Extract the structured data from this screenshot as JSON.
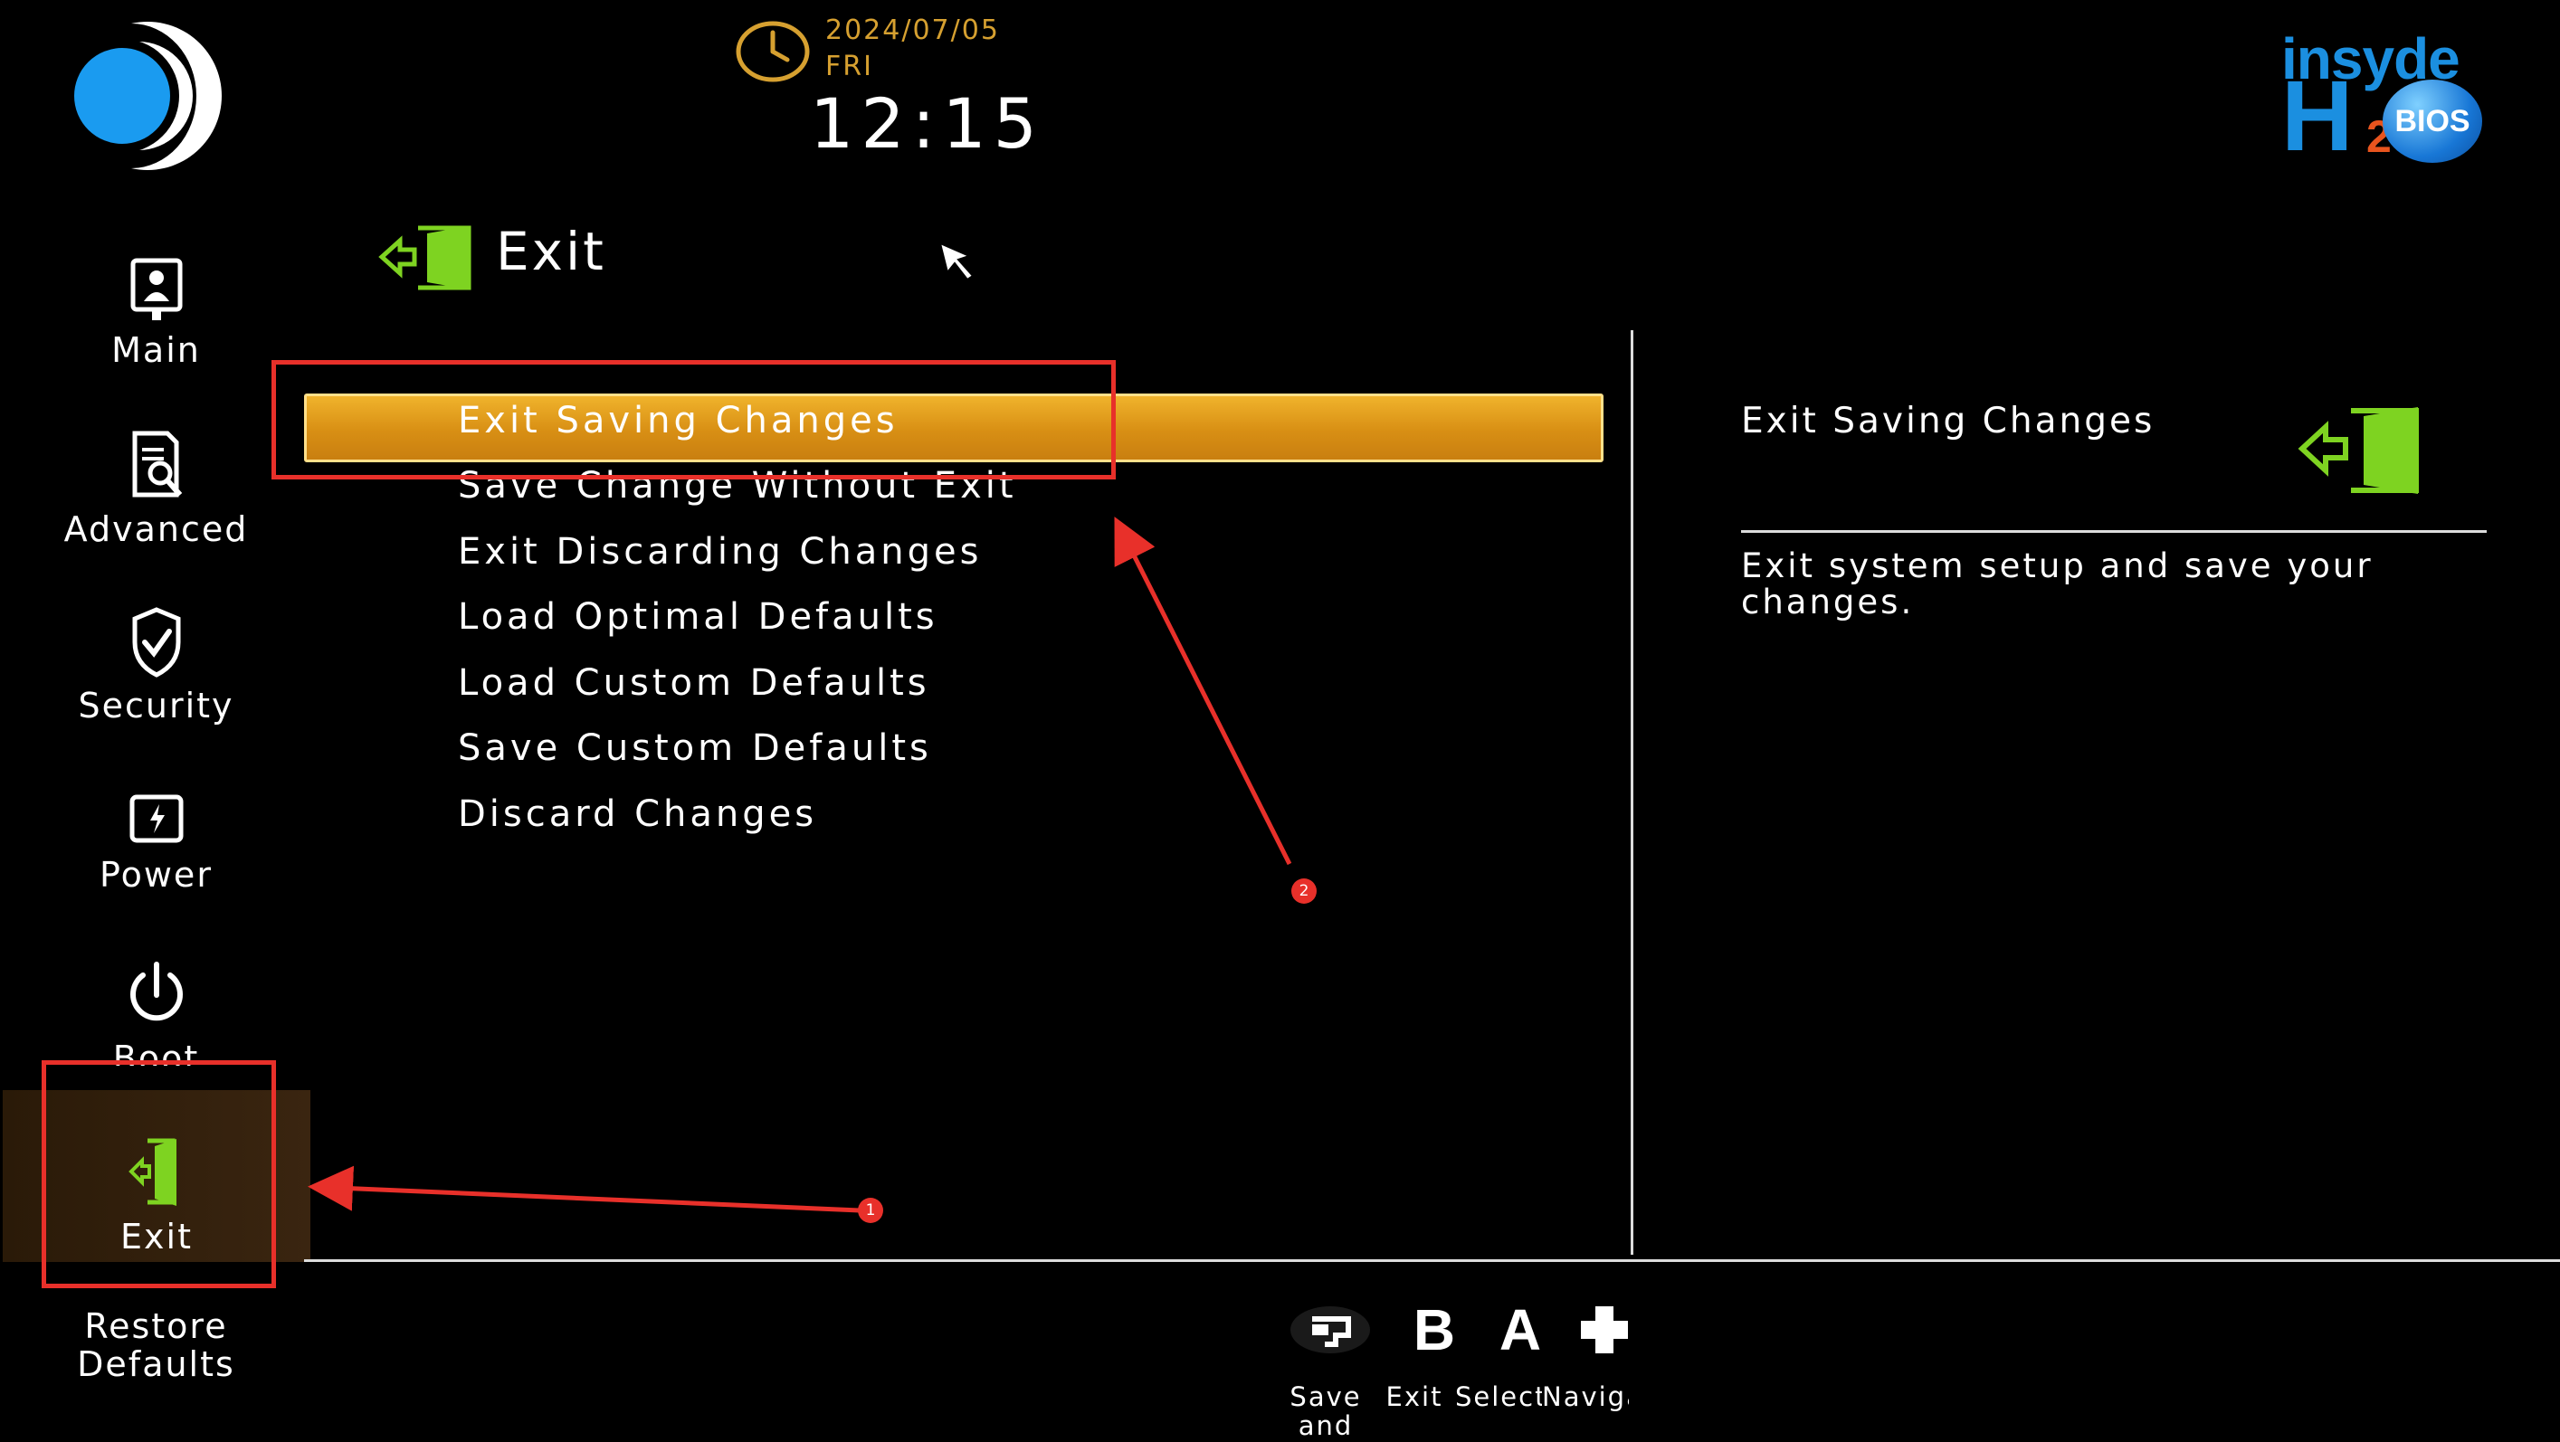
{
  "header": {
    "date": "2024/07/05",
    "day": "FRI",
    "time": "12:15",
    "brand": {
      "insyde": "insyde",
      "h": "H",
      "two": "2",
      "bios": "BIOS"
    }
  },
  "sidebar": {
    "items": [
      {
        "label": "Main",
        "icon": "main-icon"
      },
      {
        "label": "Advanced",
        "icon": "advanced-icon"
      },
      {
        "label": "Security",
        "icon": "security-icon"
      },
      {
        "label": "Power",
        "icon": "power-icon"
      },
      {
        "label": "Boot",
        "icon": "boot-icon"
      },
      {
        "label": "Exit",
        "icon": "exit-door-icon",
        "selected": true
      }
    ],
    "restore_line1": "Restore",
    "restore_line2": "Defaults"
  },
  "page": {
    "title": "Exit"
  },
  "menu": {
    "items": [
      "Exit Saving Changes",
      "Save Change Without Exit",
      "Exit Discarding Changes",
      "Load Optimal Defaults",
      "Load Custom Defaults",
      "Save Custom Defaults",
      "Discard Changes"
    ],
    "selected_index": 0
  },
  "help": {
    "title": "Exit Saving Changes",
    "description": "Exit system setup and save your changes."
  },
  "footer": {
    "keys": [
      {
        "glyph": "",
        "icon": "save-key-icon",
        "label": "Save and"
      },
      {
        "glyph": "B",
        "label": "Exit"
      },
      {
        "glyph": "A",
        "label": "Select"
      },
      {
        "glyph": "",
        "icon": "dpad-icon",
        "label": "Navigati"
      }
    ]
  },
  "annotations": {
    "badge1": "1",
    "badge2": "2"
  },
  "colors": {
    "accent": "#e39a1c",
    "highlight_border": "#ffe08a",
    "date_text": "#d6a030",
    "icon_green": "#7ed321",
    "annotation_red": "#e8302a",
    "brand_blue": "#1b8fe0"
  }
}
